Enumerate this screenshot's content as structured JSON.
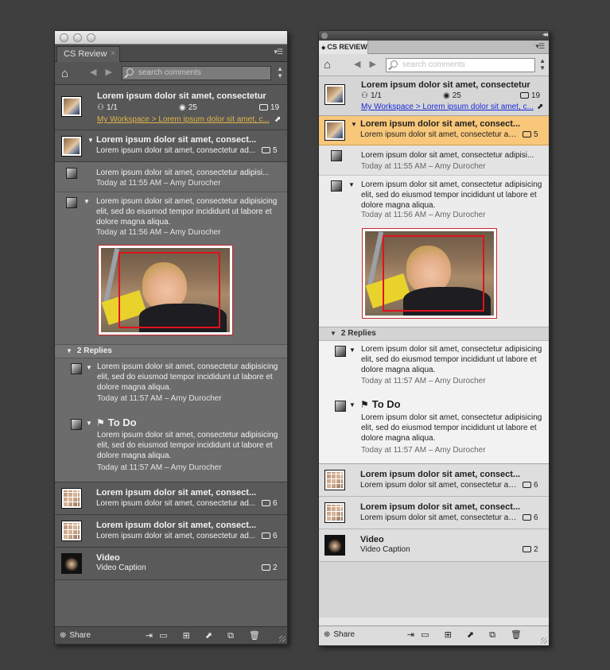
{
  "panel_title_dark": "CS Review",
  "panel_title_light": "CS REVIEW",
  "tab_close": "×",
  "flyout_glyph": "▾☰",
  "light_title_arrows": "◂◂",
  "search_placeholder": "search comments",
  "icons": {
    "home": "⌂",
    "nav": "◀ ▶",
    "spinner": "▲\n▼",
    "disclosure": "▼",
    "person": "⚇",
    "eye": "◉",
    "open_link": "⬈",
    "flag": "⚑",
    "share": "⊕"
  },
  "top_review": {
    "title": "Lorem ipsum dolor sit amet, consectetur",
    "participants": "1/1",
    "views": "25",
    "comments": "19",
    "link": "My Workspace > Lorem ipsum dolor sit amet, c..."
  },
  "thread": {
    "title": "Lorem ipsum dolor sit amet, consect...",
    "subtitle": "Lorem ipsum dolor sit amet, consectetur ad...",
    "count": "5"
  },
  "comment1": {
    "text": "Lorem ipsum dolor sit amet, consectetur adipisi...",
    "meta": "Today at 11:55 AM – Amy Durocher"
  },
  "comment2": {
    "text": "Lorem ipsum dolor sit amet, consectetur adipisicing elit, sed do eiusmod tempor incididunt ut labore et dolore magna aliqua.",
    "meta": "Today at 11:56 AM – Amy Durocher"
  },
  "replies_header": "2 Replies",
  "reply1": {
    "text": "Lorem ipsum dolor sit amet, consectetur adipisicing elit, sed do eiusmod tempor incididunt ut labore et dolore magna aliqua.",
    "meta": "Today at 11:57 AM – Amy Durocher"
  },
  "reply2": {
    "status": "To Do",
    "text": "Lorem ipsum dolor sit amet, consectetur adipisicing elit, sed do eiusmod tempor incididunt ut labore et dolore magna aliqua.",
    "meta": "Today at 11:57 AM – Amy Durocher"
  },
  "file1": {
    "title": "Lorem ipsum dolor sit amet, consect...",
    "subtitle": "Lorem ipsum dolor sit amet, consectetur ad...",
    "count": "6"
  },
  "file2": {
    "title": "Lorem ipsum dolor sit amet, consect...",
    "subtitle": "Lorem ipsum dolor sit amet, consectetur ad...",
    "count": "6"
  },
  "video": {
    "title": "Video",
    "caption": "Video Caption",
    "count": "2"
  },
  "bottombar": {
    "share_label": "Share",
    "actions": "⇥▭ ⊞ ⬈ ⧉ 🗑"
  },
  "colors": {
    "dark_panel_bg": "#5e5e5e",
    "light_panel_bg": "#e4e4e4",
    "selected_row": "#f8c77a",
    "link_dark": "#e0b44a",
    "link_light": "#1a2bd8",
    "annotation_red": "#e0121c"
  }
}
